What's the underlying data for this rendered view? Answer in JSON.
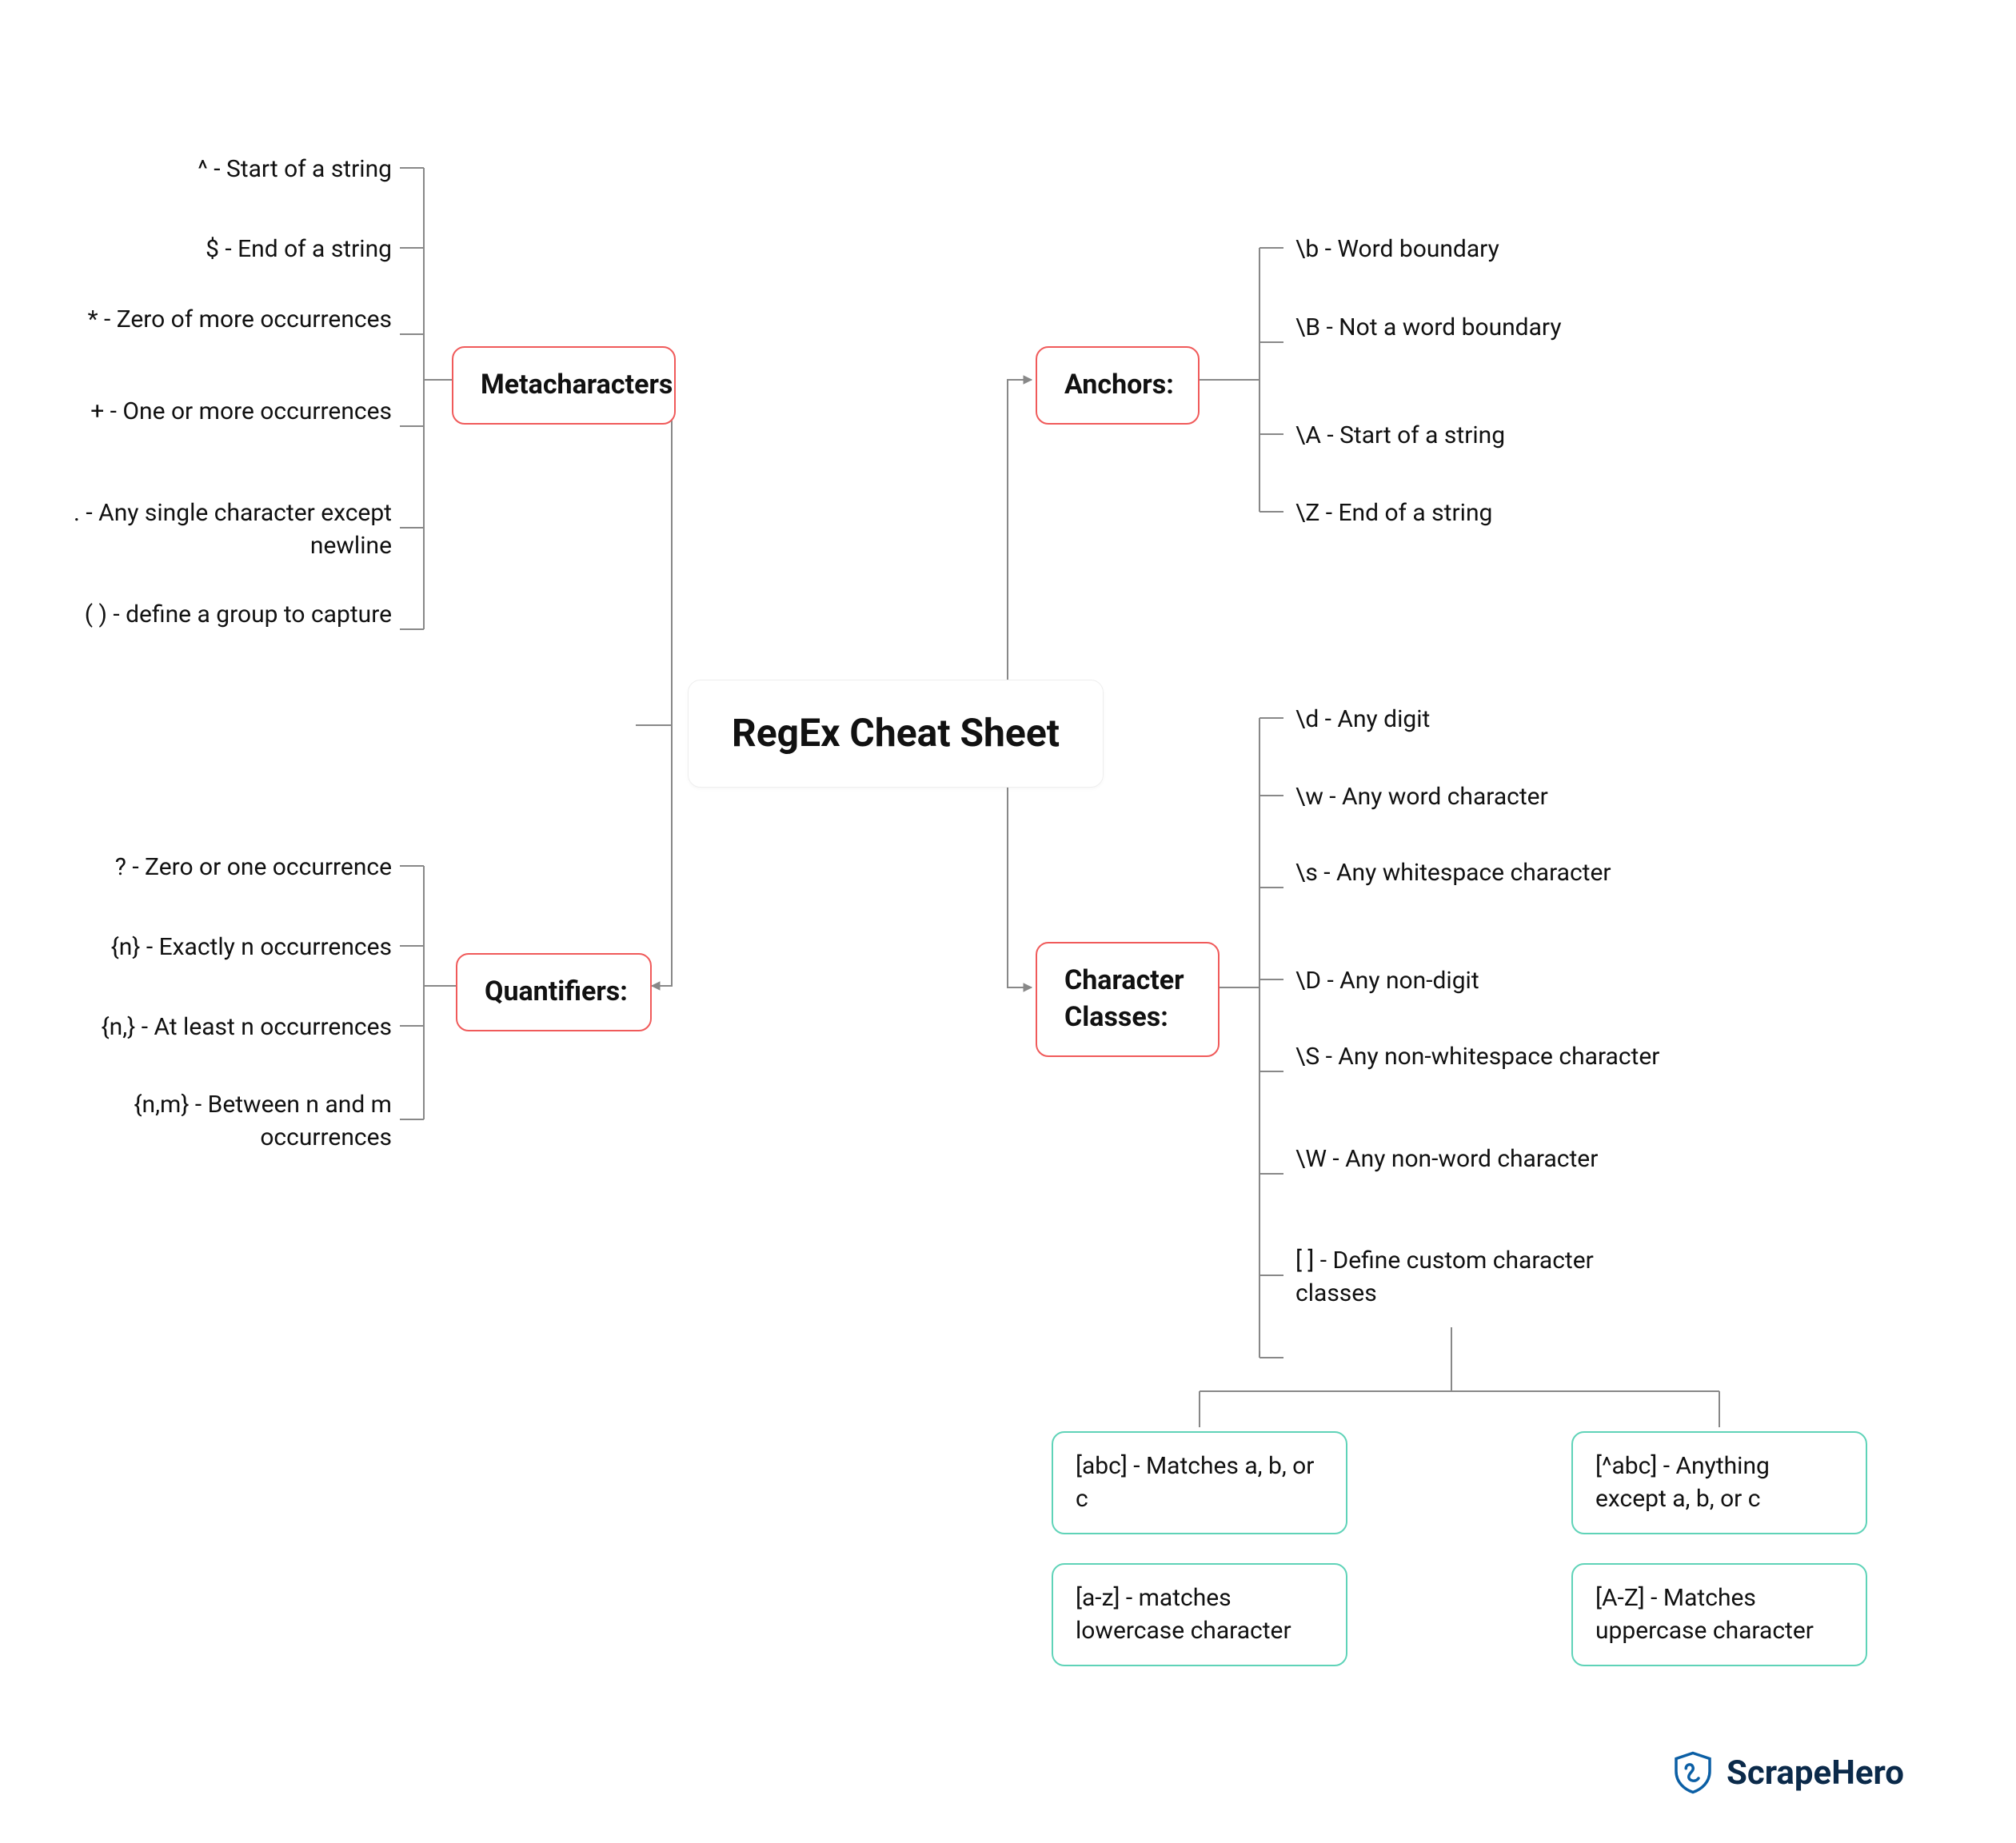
{
  "title": "RegEx Cheat Sheet",
  "branches": {
    "metacharacters": {
      "label": "Metacharacters",
      "items": [
        "^ - Start of a string",
        "$ - End of a string",
        "* - Zero of more occurrences",
        "+ - One or more occurrences",
        ". - Any single character except newline",
        "( ) - define a group to capture"
      ]
    },
    "quantifiers": {
      "label": "Quantifiers:",
      "items": [
        "? - Zero or one occurrence",
        "{n} - Exactly n occurrences",
        "{n,} - At least n occurrences",
        "{n,m} - Between n and m occurrences"
      ]
    },
    "anchors": {
      "label": "Anchors:",
      "items": [
        "\\b - Word boundary",
        "\\B - Not a word boundary",
        "\\A - Start of a string",
        "\\Z - End of a string"
      ]
    },
    "character_classes": {
      "label": "Character Classes:",
      "items": [
        "\\d - Any digit",
        "\\w - Any word character",
        "\\s - Any whitespace character",
        "\\D - Any non-digit",
        "\\S - Any non-whitespace character",
        "\\W - Any non-word character",
        "[ ] - Define custom character classes"
      ],
      "subitems": [
        "[abc] - Matches a, b, or c",
        "[^abc] - Anything except a, b, or c",
        "[a-z] - matches lowercase character",
        "[A-Z] - Matches uppercase character"
      ]
    }
  },
  "footer": {
    "brand": "ScrapeHero"
  },
  "colors": {
    "red": "#f05a5a",
    "teal": "#5fd3b8",
    "wire": "#888"
  },
  "chart_data": {
    "type": "mindmap",
    "root": "RegEx Cheat Sheet",
    "children": [
      {
        "name": "Metacharacters",
        "side": "left",
        "items": [
          "^ - Start of a string",
          "$ - End of a string",
          "* - Zero of more occurrences",
          "+ - One or more occurrences",
          ". - Any single character except newline",
          "( ) - define a group to capture"
        ]
      },
      {
        "name": "Quantifiers:",
        "side": "left",
        "items": [
          "? - Zero or one occurrence",
          "{n} - Exactly n occurrences",
          "{n,} - At least n occurrences",
          "{n,m} - Between n and m occurrences"
        ]
      },
      {
        "name": "Anchors:",
        "side": "right",
        "items": [
          "\\b - Word boundary",
          "\\B - Not a word boundary",
          "\\A - Start of a string",
          "\\Z - End of a string"
        ]
      },
      {
        "name": "Character Classes:",
        "side": "right",
        "items": [
          "\\d - Any digit",
          "\\w - Any word character",
          "\\s - Any whitespace character",
          "\\D - Any non-digit",
          "\\S - Any non-whitespace character",
          "\\W - Any non-word character",
          "[ ] - Define custom character classes"
        ],
        "children": [
          "[abc] - Matches a, b, or c",
          "[^abc] - Anything except a, b, or c",
          "[a-z] - matches lowercase character",
          "[A-Z] - Matches uppercase character"
        ]
      }
    ]
  }
}
